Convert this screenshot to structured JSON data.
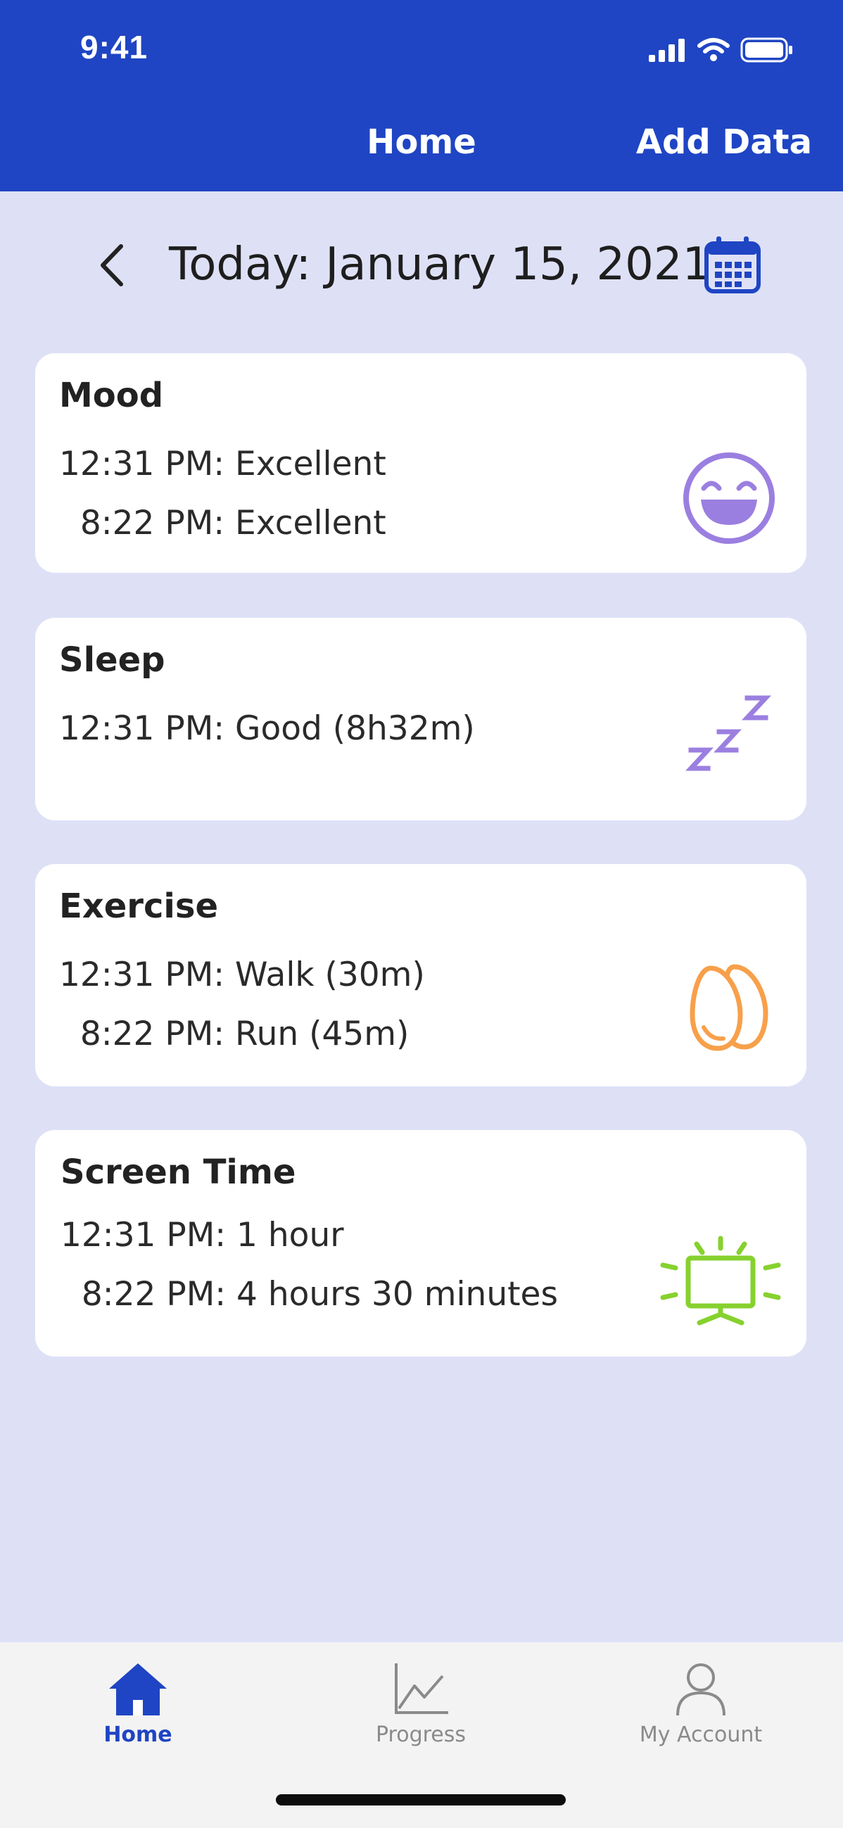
{
  "status_bar": {
    "time": "9:41",
    "icons": [
      "cellular-signal-icon",
      "wifi-icon",
      "battery-icon"
    ]
  },
  "header": {
    "title": "Home",
    "action_label": "Add Data",
    "background_color": "#1f45c4"
  },
  "date_nav": {
    "label": "Today: January 15, 2021",
    "back_icon": "chevron-left-icon",
    "calendar_icon": "calendar-icon"
  },
  "cards": {
    "mood": {
      "title": "Mood",
      "entries": [
        "12:31 PM: Excellent",
        "  8:22 PM: Excellent"
      ],
      "icon": "smiling-face-icon",
      "icon_color": "#9b7fe0"
    },
    "sleep": {
      "title": "Sleep",
      "entries": [
        "12:31 PM: Good (8h32m)"
      ],
      "icon": "zzz-sleep-icon",
      "icon_color": "#9b7fe0"
    },
    "exercise": {
      "title": "Exercise",
      "entries": [
        "12:31 PM: Walk (30m)",
        "  8:22 PM: Run (45m)"
      ],
      "icon": "footprints-icon",
      "icon_color": "#f7a04b"
    },
    "screen_time": {
      "title": "Screen Time",
      "entries": [
        "12:31 PM: 1 hour",
        "  8:22 PM: 4 hours 30 minutes"
      ],
      "icon": "tv-screen-icon",
      "icon_color": "#86d12e"
    }
  },
  "tab_bar": {
    "tabs": [
      {
        "label": "Home",
        "icon": "home-icon",
        "active": true
      },
      {
        "label": "Progress",
        "icon": "line-chart-icon",
        "active": false
      },
      {
        "label": "My Account",
        "icon": "user-icon",
        "active": false
      }
    ],
    "active_color": "#1f45c4",
    "inactive_color": "#8a8a8a"
  }
}
